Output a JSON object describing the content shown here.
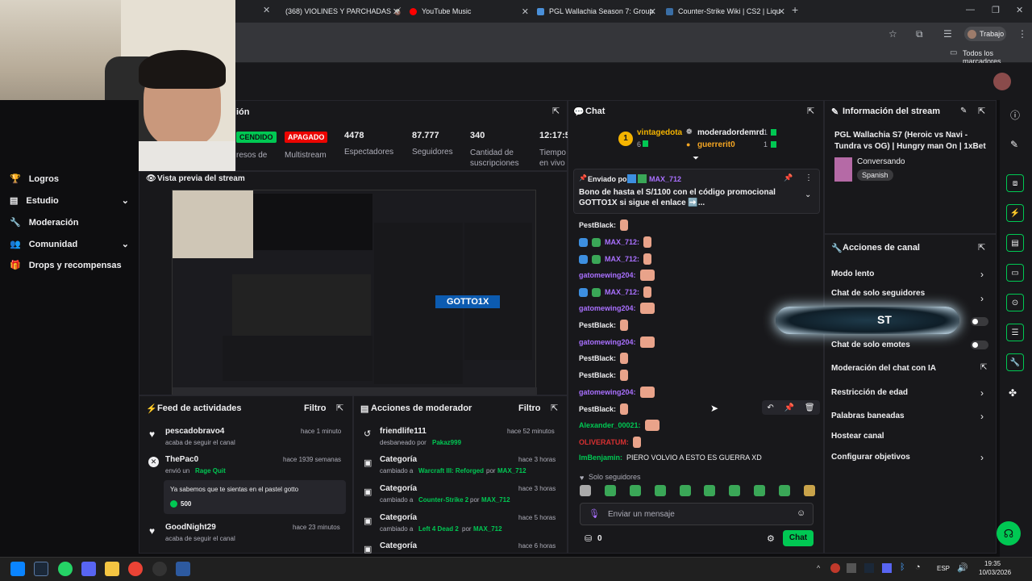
{
  "browser": {
    "tabs": [
      {
        "label": "(368) VIOLINES Y PARCHADAS 🧉",
        "color": "#ff0000"
      },
      {
        "label": "YouTube Music",
        "color": "#ff0000"
      },
      {
        "label": "PGL Wallachia Season 7: Group",
        "color": "#4a90d9"
      },
      {
        "label": "Counter-Strike Wiki | CS2 | Liqu",
        "color": "#3a6ea5"
      }
    ],
    "profile_label": "Trabajo",
    "bookmarks_label": "Todos los marcadores"
  },
  "sidebar": {
    "items": [
      {
        "label": "Logros",
        "icon": "trophy-icon"
      },
      {
        "label": "Estudio",
        "icon": "studio-icon"
      },
      {
        "label": "Moderación",
        "icon": "wrench-icon"
      },
      {
        "label": "Comunidad",
        "icon": "people-icon"
      },
      {
        "label": "Drops y recompensas",
        "icon": "gift-icon"
      }
    ]
  },
  "stats": {
    "title_partial": "ión",
    "badge_on": "CENDIDO",
    "badge_off": "APAGADO",
    "multistream": "Multistream",
    "ingresos_partial": "resos de",
    "viewers_value": "4478",
    "viewers_label": "Espectadores",
    "followers_value": "87.777",
    "followers_label": "Seguidores",
    "subs_value": "340",
    "subs_label": "Cantidad de suscripciones",
    "time_value": "12:17:5",
    "time_label": "Tiempo en vivo"
  },
  "preview": {
    "title": "Vista previa del stream",
    "overlay": "GOTTO1X"
  },
  "activity": {
    "title": "Feed de actividades",
    "filter": "Filtro",
    "items": [
      {
        "name": "pescadobravo4",
        "desc": "acaba de seguir el canal",
        "time": "hace 1 minuto"
      },
      {
        "name": "ThePac0",
        "desc_pre": "envió un",
        "desc_link": "Rage Quit",
        "time": "hace 1939 semanas",
        "message": "Ya sabemos que te sientas en el pastel gotto",
        "amount": "500"
      },
      {
        "name": "GoodNight29",
        "desc": "acaba de seguir el canal",
        "time": "hace 23 minutos"
      }
    ]
  },
  "modactions": {
    "title": "Acciones de moderador",
    "filter": "Filtro",
    "items": [
      {
        "name": "friendlife111",
        "desc_pre": "desbaneado por",
        "user": "Pakaz999",
        "time": "hace 52 minutos"
      },
      {
        "name": "Categoría",
        "desc_pre": "cambiado a",
        "game": "Warcraft III: Reforged",
        "por": "por",
        "user": "MAX_712",
        "time": "hace 3 horas"
      },
      {
        "name": "Categoría",
        "desc_pre": "cambiado a",
        "game": "Counter-Strike 2",
        "por": "por",
        "user": "MAX_712",
        "time": "hace 3 horas"
      },
      {
        "name": "Categoría",
        "desc_pre": "cambiado a",
        "game": "Left 4 Dead 2",
        "por": "por",
        "user": "MAX_712",
        "time": "hace 5 horas"
      },
      {
        "name": "Categoría",
        "time": "hace 6 horas"
      }
    ]
  },
  "chat": {
    "title": "Chat",
    "leader_rank": "1",
    "leader_name": "vintagedota",
    "leader_count": "6",
    "top1_name": "moderadordemrd",
    "top1_count": "1",
    "top2_name": "guerrerit0",
    "top2_count": "1",
    "pinned_prefix": "Enviado por",
    "pinned_user": "MAX_712",
    "pinned_text": "Bono de hasta el S/1100 con el código promocional GOTTO1X si sigue el enlace ➡️...",
    "messages": [
      {
        "user": "PestBlack:",
        "color": "#efeff1",
        "badges": []
      },
      {
        "user": "MAX_712:",
        "color": "#a970ff",
        "badges": [
          "vip",
          "mod"
        ]
      },
      {
        "user": "MAX_712:",
        "color": "#a970ff",
        "badges": [
          "vip",
          "mod"
        ]
      },
      {
        "user": "gatomewing204:",
        "color": "#a970ff",
        "badges": []
      },
      {
        "user": "MAX_712:",
        "color": "#a970ff",
        "badges": [
          "vip",
          "mod"
        ]
      },
      {
        "user": "gatomewing204:",
        "color": "#a970ff",
        "badges": []
      },
      {
        "user": "PestBlack:",
        "color": "#efeff1",
        "badges": []
      },
      {
        "user": "gatomewing204:",
        "color": "#a970ff",
        "badges": []
      },
      {
        "user": "PestBlack:",
        "color": "#efeff1",
        "badges": []
      },
      {
        "user": "PestBlack:",
        "color": "#efeff1",
        "badges": []
      },
      {
        "user": "gatomewing204:",
        "color": "#a970ff",
        "badges": []
      },
      {
        "user": "PestBlack:",
        "color": "#efeff1",
        "badges": []
      },
      {
        "user": "Alexander_00021:",
        "color": "#00c853",
        "badges": []
      },
      {
        "user": "OLIVERATUM:",
        "color": "#d63031",
        "badges": []
      },
      {
        "user": "ImBenjamin:",
        "color": "#00c853",
        "badges": [],
        "text": "PIERO VOLVIO A ESTO ES GUERRA XD"
      }
    ],
    "followers_only": "Solo seguidores",
    "input_placeholder": "Enviar un mensaje",
    "points": "0",
    "send_label": "Chat"
  },
  "info": {
    "title": "Información del stream",
    "stream_title": "PGL Wallachia S7 (Heroic vs Navi - Tundra vs OG) | Hungry man On | 1xBet ...",
    "category": "Conversando",
    "language": "Spanish"
  },
  "actions": {
    "title": "Acciones de canal",
    "items": [
      {
        "label": "Modo lento",
        "kind": "chevron"
      },
      {
        "label": "Chat de solo seguidores",
        "kind": "chevron"
      },
      {
        "label": "",
        "kind": "toggle"
      },
      {
        "label": "Chat de solo emotes",
        "kind": "toggle"
      },
      {
        "label": "Moderación del chat con IA",
        "kind": "external"
      },
      {
        "label": "Restricción de edad",
        "kind": "chevron"
      },
      {
        "label": "Palabras baneadas",
        "kind": "chevron"
      },
      {
        "label": "Hostear canal",
        "kind": "none"
      },
      {
        "label": "Configurar objetivos",
        "kind": "chevron"
      }
    ],
    "overlay_text": "ST"
  },
  "taskbar": {
    "lang": "ESP",
    "time": "19:35",
    "date": "10/03/2026"
  }
}
